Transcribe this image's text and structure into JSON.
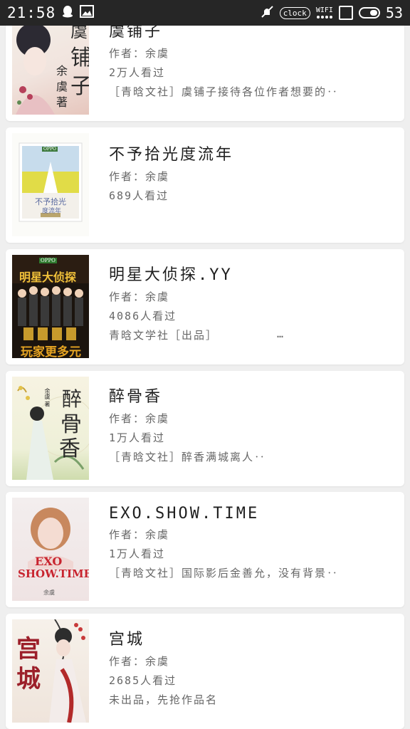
{
  "status_bar": {
    "time": "21:58",
    "clock_label": "clock",
    "wifi_label": "WIFI",
    "battery": "53",
    "icons": [
      "qq-icon",
      "image-icon",
      "mute-icon",
      "wifi-icon",
      "square-icon",
      "toggle-icon"
    ]
  },
  "books": [
    {
      "title": "虞铺子",
      "author": "作者：余虞",
      "views": "2万人看过",
      "desc": "［青晗文社］虞铺子接待各位作者想要的‥",
      "cover_text": [
        "虞",
        "铺",
        "子",
        "余",
        "虞",
        "著"
      ],
      "cover_colors": [
        "#f3efe8",
        "#e9c2b7",
        "#b6405a"
      ]
    },
    {
      "title": "不予拾光度流年",
      "author": "作者：余虞",
      "views": "689人看过",
      "desc": "",
      "cover_text": [
        "OPPO",
        "不予拾光",
        "度流年"
      ],
      "cover_colors": [
        "#f4f1e8",
        "#c7d9eb",
        "#e2dd49"
      ]
    },
    {
      "title": "明星大侦探.YY",
      "author": "作者：余虞",
      "views": "4086人看过",
      "desc": "青晗文学社［出品］",
      "desc_more": "…",
      "cover_text": [
        "OPPO",
        "明星大侦探",
        "玩家更多元"
      ],
      "cover_colors": [
        "#1a120d",
        "#d89b27",
        "#8b5b1f"
      ]
    },
    {
      "title": "醉骨香",
      "author": "作者：余虞",
      "views": "1万人看过",
      "desc": "［青晗文社］醉香满城离人‥",
      "cover_text": [
        "醉",
        "骨",
        "香",
        "余虞 著"
      ],
      "cover_colors": [
        "#f6f2df",
        "#7aa06a",
        "#c7d49a"
      ]
    },
    {
      "title": "EXO.SHOW.TIME",
      "author": "作者：余虞",
      "views": "1万人看过",
      "desc": "［青晗文社］国际影后金善允，没有背景‥",
      "cover_text": [
        "EXO",
        "SHOW.TIME",
        "余虞"
      ],
      "cover_colors": [
        "#f1ecee",
        "#e7c4c2",
        "#c8242f"
      ]
    },
    {
      "title": "宫城",
      "author": "作者：余虞",
      "views": "2685人看过",
      "desc": "未出品，先抢作品名",
      "cover_text": [
        "宫",
        "城"
      ],
      "cover_colors": [
        "#f4efea",
        "#b22a2a",
        "#3b3b3b"
      ]
    }
  ]
}
